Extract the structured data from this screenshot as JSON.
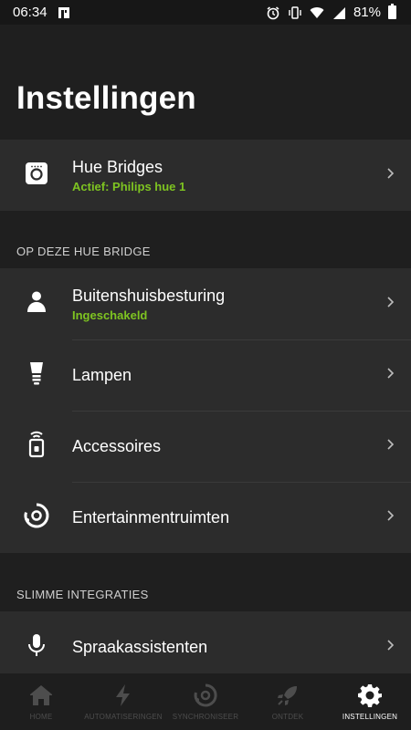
{
  "status": {
    "time": "06:34",
    "battery": "81%"
  },
  "title": "Instellingen",
  "bridges": {
    "title": "Hue Bridges",
    "subtitle": "Actief: Philips hue 1"
  },
  "section1": {
    "label": "OP DEZE HUE BRIDGE",
    "items": [
      {
        "title": "Buitenshuisbesturing",
        "subtitle": "Ingeschakeld",
        "icon": "person-icon"
      },
      {
        "title": "Lampen",
        "subtitle": "",
        "icon": "bulb-icon"
      },
      {
        "title": "Accessoires",
        "subtitle": "",
        "icon": "remote-icon"
      },
      {
        "title": "Entertainmentruimten",
        "subtitle": "",
        "icon": "entertainment-icon"
      }
    ]
  },
  "section2": {
    "label": "SLIMME INTEGRATIES",
    "items": [
      {
        "title": "Spraakassistenten",
        "subtitle": "",
        "icon": "microphone-icon"
      }
    ]
  },
  "nav": [
    {
      "label": "HOME",
      "icon": "home-icon",
      "active": false
    },
    {
      "label": "AUTOMATISERINGEN",
      "icon": "bolt-icon",
      "active": false
    },
    {
      "label": "SYNCHRONISEER",
      "icon": "sync-icon",
      "active": false
    },
    {
      "label": "ONTDEK",
      "icon": "rocket-icon",
      "active": false
    },
    {
      "label": "INSTELLINGEN",
      "icon": "gear-icon",
      "active": true
    }
  ],
  "colors": {
    "accent": "#7ec421",
    "background": "#1f1f1f",
    "card": "#2c2c2c"
  }
}
